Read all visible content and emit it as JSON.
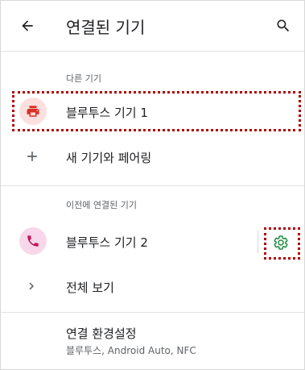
{
  "header": {
    "title": "연결된 기기"
  },
  "sections": {
    "other_devices_label": "다른 기기",
    "previously_connected_label": "이전에 연결된 기기"
  },
  "other_devices": {
    "device_1_label": "블루투스 기기 1",
    "pair_new_label": "새 기기와 페어링"
  },
  "previous_devices": {
    "device_2_label": "블루투스 기기 2",
    "see_all_label": "전체 보기"
  },
  "connection_prefs": {
    "title": "연결 환경설정",
    "subtitle": "블루투스, Android Auto, NFC"
  },
  "colors": {
    "printer_icon": "#d93025",
    "printer_bg": "#fbe0de",
    "phone_icon": "#c2185b",
    "phone_bg": "#f8d7ea",
    "gear_icon": "#1e8e3e",
    "highlight": "#b00000"
  },
  "icons": {
    "back": "arrow-left-icon",
    "search": "search-icon",
    "device_1": "printer-icon",
    "pair": "plus-icon",
    "device_2": "phone-icon",
    "settings": "gear-icon",
    "see_all": "chevron-right-icon"
  }
}
